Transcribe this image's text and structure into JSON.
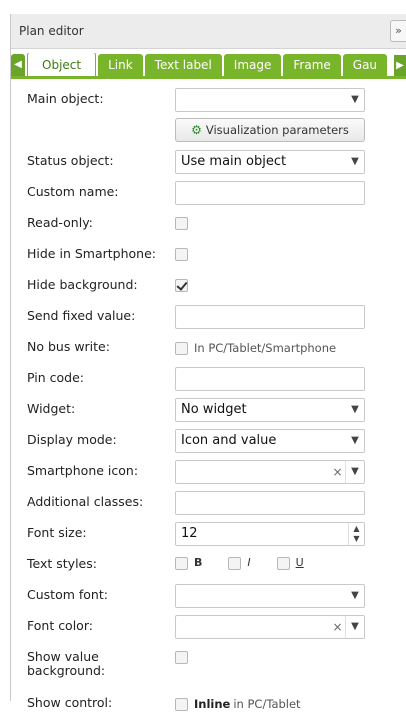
{
  "panel": {
    "title": "Plan editor",
    "collapse_icon": "»"
  },
  "tabs": [
    {
      "label": "Object",
      "active": true
    },
    {
      "label": "Link"
    },
    {
      "label": "Text label"
    },
    {
      "label": "Image"
    },
    {
      "label": "Frame"
    },
    {
      "label": "Gau"
    }
  ],
  "fields": {
    "main_object": {
      "label": "Main object:",
      "value": ""
    },
    "visualization_button": {
      "label": "Visualization parameters"
    },
    "status_object": {
      "label": "Status object:",
      "value": "Use main object"
    },
    "custom_name": {
      "label": "Custom name:",
      "value": ""
    },
    "read_only": {
      "label": "Read-only:",
      "checked": false
    },
    "hide_smartphone": {
      "label": "Hide in Smartphone:",
      "checked": false
    },
    "hide_background": {
      "label": "Hide background:",
      "checked": true
    },
    "send_fixed_value": {
      "label": "Send fixed value:",
      "value": ""
    },
    "no_bus_write": {
      "label": "No bus write:",
      "checked": false,
      "note": "In PC/Tablet/Smartphone"
    },
    "pin_code": {
      "label": "Pin code:",
      "value": ""
    },
    "widget": {
      "label": "Widget:",
      "value": "No widget"
    },
    "display_mode": {
      "label": "Display mode:",
      "value": "Icon and value"
    },
    "smartphone_icon": {
      "label": "Smartphone icon:",
      "value": ""
    },
    "additional_classes": {
      "label": "Additional classes:",
      "value": ""
    },
    "font_size": {
      "label": "Font size:",
      "value": "12"
    },
    "text_styles": {
      "label": "Text styles:",
      "bold": "B",
      "italic": "I",
      "underline": "U"
    },
    "custom_font": {
      "label": "Custom font:",
      "value": ""
    },
    "font_color": {
      "label": "Font color:",
      "value": ""
    },
    "show_value_bg": {
      "label": "Show value background:",
      "checked": false
    },
    "show_control": {
      "label": "Show control:",
      "checked": false,
      "note_bold": "Inline",
      "note": "in PC/Tablet"
    }
  },
  "icons": {
    "clear": "×",
    "caret": "▼",
    "spin_up": "▲",
    "spin_down": "▼",
    "tab_left": "◀",
    "tab_right": "▶",
    "visualization": "⚙"
  }
}
